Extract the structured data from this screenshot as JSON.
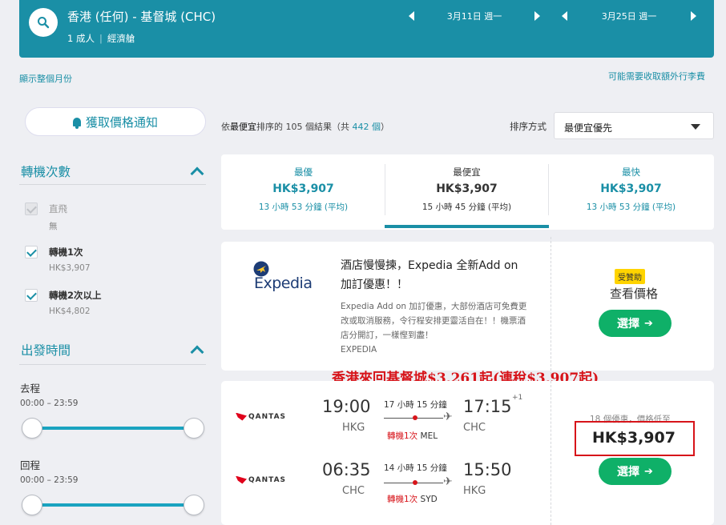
{
  "header": {
    "route": "香港 (任何) - 基督城 (CHC)",
    "passengers": "1 成人",
    "cabin": "經濟艙",
    "depart_date": "3月11日 週一",
    "return_date": "3月25日 週一"
  },
  "links": {
    "show_month": "顯示整個月份",
    "baggage_fees": "可能需要收取額外行李費"
  },
  "sidebar": {
    "price_alert": "獲取價格通知",
    "stops_title": "轉機次數",
    "stops": [
      {
        "label": "直飛",
        "sub": "無",
        "checked": true,
        "disabled": true
      },
      {
        "label": "轉機1次",
        "sub": "HK$3,907",
        "checked": true,
        "disabled": false
      },
      {
        "label": "轉機2次以上",
        "sub": "HK$4,802",
        "checked": true,
        "disabled": false
      }
    ],
    "departure_title": "出發時間",
    "outbound_label": "去程",
    "outbound_range": "00:00 – 23:59",
    "return_label": "回程",
    "return_range": "00:00 – 23:59"
  },
  "sort": {
    "info_prefix": "依",
    "info_bold": "最便宜",
    "info_mid": "排序的 105 個結果（共",
    "info_count": "442 個",
    "info_suffix": "）",
    "label": "排序方式",
    "selected": "最便宜優先"
  },
  "tabs": [
    {
      "name": "最優",
      "price": "HK$3,907",
      "duration": "13 小時 53 分鐘 (平均)",
      "active": false
    },
    {
      "name": "最便宜",
      "price": "HK$3,907",
      "duration": "15 小時 45 分鐘 (平均)",
      "active": true
    },
    {
      "name": "最快",
      "price": "HK$3,907",
      "duration": "13 小時 53 分鐘 (平均)",
      "active": false
    }
  ],
  "ad": {
    "brand": "Expedia",
    "title": "酒店慢慢揀，Expedia 全新Add on 加訂優惠！！",
    "desc": "Expedia Add on 加訂優惠，大部份酒店可免費更改或取消服務，令行程安排更靈活自在！！機票酒店分開訂，一樣慳到盡！",
    "source": "EXPEDIA",
    "badge": "受贊助",
    "see_price": "查看價格",
    "select": "選擇"
  },
  "promo": "香港來回基督城$3,261起(連稅$3,907起)",
  "flight": {
    "airline": "QANTAS",
    "outbound": {
      "dep": "19:00",
      "dep_apt": "HKG",
      "arr": "17:15",
      "plus": "+1",
      "arr_apt": "CHC",
      "duration": "17 小時 15 分鐘",
      "stops": "轉機1次",
      "via": "MEL"
    },
    "inbound": {
      "dep": "06:35",
      "dep_apt": "CHC",
      "arr": "15:50",
      "arr_apt": "HKG",
      "duration": "14 小時 15 分鐘",
      "stops": "轉機1次",
      "via": "SYD"
    },
    "offers": "18 個優惠，價格低至",
    "price": "HK$3,907",
    "select": "選擇"
  },
  "colors": {
    "brand": "#1a8fa6",
    "green": "#0fb068",
    "red": "#d7141a"
  }
}
